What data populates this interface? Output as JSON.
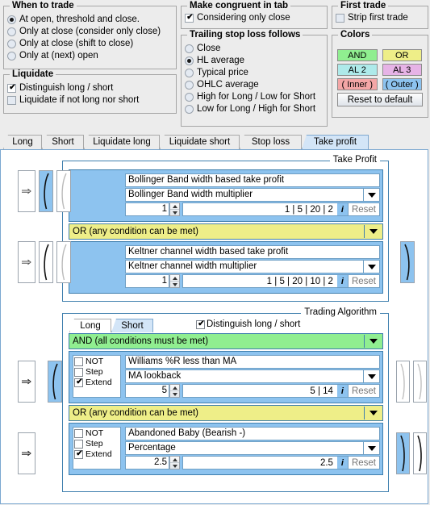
{
  "groups": {
    "when_to_trade": {
      "title": "When to trade",
      "options": [
        {
          "label": "At open, threshold and close.",
          "checked": true
        },
        {
          "label": "Only at close (consider only close)",
          "checked": false
        },
        {
          "label": "Only at close (shift to close)",
          "checked": false
        },
        {
          "label": "Only at (next) open",
          "checked": false
        }
      ]
    },
    "liquidate": {
      "title": "Liquidate",
      "options": [
        {
          "label": "Distinguish long / short",
          "checked": true
        },
        {
          "label": "Liquidate if not long nor short",
          "checked": false
        }
      ]
    },
    "congruent": {
      "title": "Make congruent in tab",
      "options": [
        {
          "label": "Considering only close",
          "checked": true
        }
      ]
    },
    "trailing": {
      "title": "Trailing stop loss follows",
      "options": [
        {
          "label": "Close",
          "checked": false
        },
        {
          "label": "HL average",
          "checked": true
        },
        {
          "label": "Typical price",
          "checked": false
        },
        {
          "label": "OHLC average",
          "checked": false
        },
        {
          "label": "High for Long / Low for Short",
          "checked": false
        },
        {
          "label": "Low for Long / High for Short",
          "checked": false
        }
      ]
    },
    "first_trade": {
      "title": "First trade",
      "options": [
        {
          "label": "Strip first trade",
          "checked": false
        }
      ]
    },
    "colors": {
      "title": "Colors",
      "swatches": [
        {
          "label": "AND",
          "bg": "#90ee90",
          "fg": "#000000"
        },
        {
          "label": "OR",
          "bg": "#eeee88",
          "fg": "#000000"
        },
        {
          "label": "AL 2",
          "bg": "#aeeaea",
          "fg": "#000000"
        },
        {
          "label": "AL 3",
          "bg": "#e6b3e6",
          "fg": "#000000"
        },
        {
          "label": "( Inner )",
          "bg": "#f4a6a6",
          "fg": "#000000"
        },
        {
          "label": "( Outer )",
          "bg": "#8dc3ef",
          "fg": "#000000"
        }
      ],
      "reset_label": "Reset to default"
    }
  },
  "tabs": [
    {
      "label": "Long",
      "selected": false
    },
    {
      "label": "Short",
      "selected": false
    },
    {
      "label": "Liquidate long",
      "selected": false
    },
    {
      "label": "Liquidate short",
      "selected": false
    },
    {
      "label": "Stop loss",
      "selected": false
    },
    {
      "label": "Take profit",
      "selected": true
    }
  ],
  "take_profit": {
    "title": "Take Profit",
    "rows": [
      {
        "name_field": "Bollinger Band width based take profit",
        "param_combo": "Bollinger Band width multiplier",
        "spin_value": "1",
        "info_values": "1 | 5 | 20 | 2",
        "info_icon": "i",
        "reset_label": "Reset",
        "left_arrow_icon": "implies-icon",
        "paren_open_selected": true,
        "paren_open2_selected": false,
        "right_paren_selected": false
      },
      {
        "name_field": "Keltner channel width based take profit",
        "param_combo": "Keltner channel width multiplier",
        "spin_value": "1",
        "info_values": "1 | 5 | 20 | 10 | 2",
        "info_icon": "i",
        "reset_label": "Reset",
        "left_arrow_icon": "implies-icon",
        "paren_open_selected": false,
        "paren_open2_selected": false,
        "right_paren_selected": true
      }
    ],
    "or_bar": "OR    (any condition can be met)"
  },
  "trading_algorithm": {
    "title": "Trading Algorithm",
    "inner_tabs": [
      {
        "label": "Long",
        "selected": false
      },
      {
        "label": "Short",
        "selected": true
      }
    ],
    "distinguish": {
      "label": "Distinguish long / short",
      "checked": true
    },
    "and_bar": "AND   (all conditions must be met)",
    "or_bar": "OR    (any condition can be met)",
    "rows": [
      {
        "flags": [
          {
            "label": "NOT",
            "checked": false
          },
          {
            "label": "Step",
            "checked": false
          },
          {
            "label": "Extend",
            "checked": true
          }
        ],
        "name_field": "Williams %R less than MA",
        "param_combo": "MA lookback",
        "spin_value": "5",
        "info_values": "5 | 14",
        "info_icon": "i",
        "reset_label": "Reset",
        "left_arrow_icon": "implies-icon",
        "paren_open_selected": true,
        "right_paren1_selected": false,
        "right_paren2_selected": false
      },
      {
        "flags": [
          {
            "label": "NOT",
            "checked": false
          },
          {
            "label": "Step",
            "checked": false
          },
          {
            "label": "Extend",
            "checked": true
          }
        ],
        "name_field": "Abandoned Baby (Bearish -)",
        "param_combo": "Percentage",
        "spin_value": "2.5",
        "info_values": "2.5",
        "info_icon": "i",
        "reset_label": "Reset",
        "left_arrow_icon": "implies-icon",
        "paren_open_selected": false,
        "right_paren1_selected": true,
        "right_paren2_selected": false
      }
    ]
  }
}
